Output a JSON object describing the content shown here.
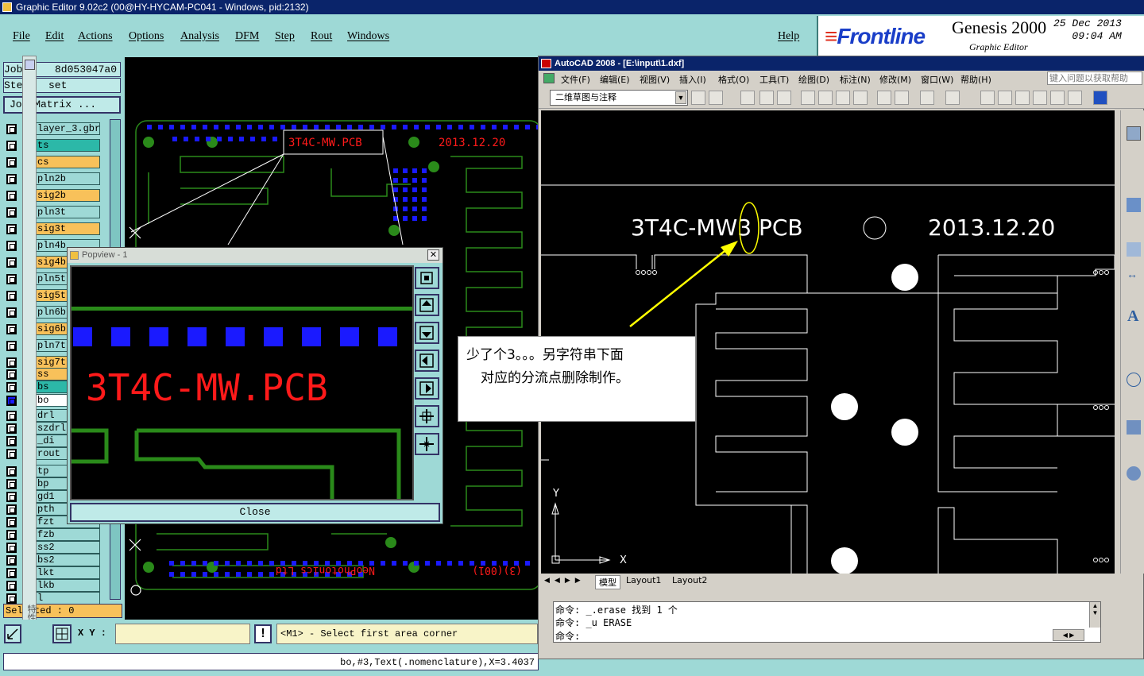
{
  "genesis": {
    "title": "Graphic Editor 9.02c2 (00@HY-HYCAM-PC041 - Windows, pid:2132)",
    "menu": [
      "File",
      "Edit",
      "Actions",
      "Options",
      "Analysis",
      "DFM",
      "Step",
      "Rout",
      "Windows"
    ],
    "help": "Help",
    "brand": {
      "logo": "Frontline",
      "product": "Genesis 2000",
      "subtitle": "Graphic Editor",
      "date": "25 Dec 2013",
      "time": "09:04 AM"
    },
    "job_label": "Job",
    "job_value": "8d053047a0",
    "step_label": "Step",
    "step_value": "set",
    "job_matrix": "Job Matrix ...",
    "vertical_tab": "特性",
    "layers": [
      {
        "name": "layer_3.gbr",
        "color": "#9ed9d6"
      },
      {
        "name": "ts",
        "color": "#2cb8a8"
      },
      {
        "name": "cs",
        "color": "#f8c15a"
      },
      {
        "name": "pln2b",
        "color": "#9ed9d6"
      },
      {
        "name": "sig2b",
        "color": "#f8c15a"
      },
      {
        "name": "pln3t",
        "color": "#9ed9d6"
      },
      {
        "name": "sig3t",
        "color": "#f8c15a"
      },
      {
        "name": "pln4b",
        "color": "#9ed9d6"
      },
      {
        "name": "sig4b",
        "color": "#f8c15a"
      },
      {
        "name": "pln5t",
        "color": "#9ed9d6"
      },
      {
        "name": "sig5t",
        "color": "#f8c15a"
      },
      {
        "name": "pln6b",
        "color": "#9ed9d6"
      },
      {
        "name": "sig6b",
        "color": "#f8c15a"
      },
      {
        "name": "pln7t",
        "color": "#9ed9d6"
      },
      {
        "name": "sig7t",
        "color": "#f8c15a"
      },
      {
        "name": "ss",
        "color": "#f8c15a"
      },
      {
        "name": "bs",
        "color": "#2cb8a8"
      },
      {
        "name": "bo",
        "color": "#ffffff"
      },
      {
        "name": "drl",
        "color": "#9ed9d6"
      },
      {
        "name": "szdrl",
        "color": "#9ed9d6"
      },
      {
        "name": "_di",
        "color": "#9ed9d6"
      },
      {
        "name": "rout",
        "color": "#9ed9d6"
      },
      {
        "name": "tp",
        "color": "#9ed9d6"
      },
      {
        "name": "bp",
        "color": "#9ed9d6"
      },
      {
        "name": "gd1",
        "color": "#9ed9d6"
      },
      {
        "name": "pth",
        "color": "#9ed9d6"
      },
      {
        "name": "fzt",
        "color": "#9ed9d6"
      },
      {
        "name": "fzb",
        "color": "#9ed9d6"
      },
      {
        "name": "ss2",
        "color": "#9ed9d6"
      },
      {
        "name": "bs2",
        "color": "#9ed9d6"
      },
      {
        "name": "lkt",
        "color": "#9ed9d6"
      },
      {
        "name": "lkb",
        "color": "#9ed9d6"
      },
      {
        "name": "l",
        "color": "#9ed9d6"
      }
    ],
    "selected": "Selected : 0",
    "xy_label": "X Y :",
    "xy_value": "",
    "prompt": "<M1> - Select first area corner",
    "status": "bo,#3,Text(.nomenclature),X=3.4037",
    "canvas_texts": {
      "board_name": "3T4C-MW.PCB",
      "board_date": "2013.12.20",
      "bottom_mirror": "NeoPhotonics Ltd",
      "bottom_mirror2": "(3)(001)"
    },
    "colors": {
      "panel": "#9ed9d6",
      "pad_blue": "#1a1aff",
      "trace_green": "#2a8a1a",
      "text_red": "#ff1a1a"
    }
  },
  "popview": {
    "title": "Popview - 1",
    "close": "Close",
    "text": "3T4C-MW.PCB"
  },
  "autocad": {
    "title": "AutoCAD 2008 - [E:\\input\\1.dxf]",
    "menu": [
      "文件(F)",
      "编辑(E)",
      "视图(V)",
      "插入(I)",
      "格式(O)",
      "工具(T)",
      "绘图(D)",
      "标注(N)",
      "修改(M)",
      "窗口(W)",
      "帮助(H)"
    ],
    "help_placeholder": "键入问题以获取帮助",
    "workspace": "二维草图与注释",
    "drawing_name": "3T4C-MW3 PCB",
    "drawing_date": "2013.12.20",
    "tabs": [
      "模型",
      "Layout1",
      "Layout2"
    ],
    "cmd_lines": [
      "命令: _.erase 找到 1 个",
      "命令: _u ERASE",
      "命令:"
    ],
    "axis_y": "Y",
    "axis_x": "X"
  },
  "callout": {
    "line1": "少了个3。。。另字符串下面",
    "line2": "对应的分流点删除制作。"
  }
}
